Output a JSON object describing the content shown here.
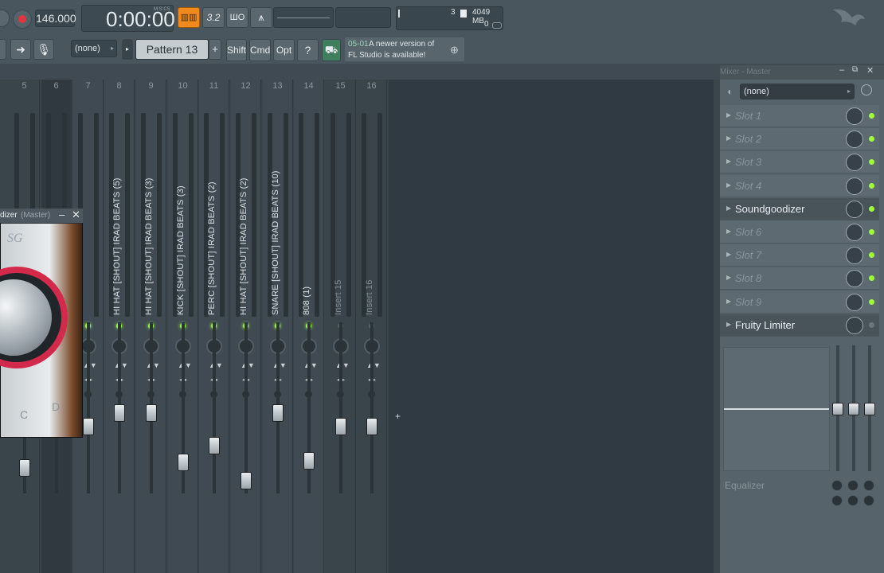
{
  "toolbar": {
    "tempo": "146.000",
    "time": "0:00:00",
    "time_units": "M:S:CS",
    "cpu": "3",
    "memory": "4049 MB",
    "voices": "0",
    "icon_32": "3.2",
    "icon_wo": "ШO"
  },
  "toolbar2": {
    "preset": "(none)",
    "pattern": "Pattern 13",
    "plus": "+",
    "shift": "Shift",
    "cmd": "Cmd",
    "opt": "Opt",
    "news_date": "05-01",
    "news_text_1": "A newer version of",
    "news_text_2": "FL Studio is available!"
  },
  "mixer": {
    "tracks": [
      {
        "num": "5",
        "name": ""
      },
      {
        "num": "6",
        "name": ""
      },
      {
        "num": "7",
        "name": ""
      },
      {
        "num": "8",
        "name": "HI HAT [SHOUT] IRAD BEATS (5)"
      },
      {
        "num": "9",
        "name": "HI HAT [SHOUT] IRAD BEATS (3)"
      },
      {
        "num": "10",
        "name": "KICK [SHOUT] IRAD BEATS (3)"
      },
      {
        "num": "11",
        "name": "PERC [SHOUT] IRAD BEATS (2)"
      },
      {
        "num": "12",
        "name": "HI HAT [SHOUT] IRAD BEATS (2)"
      },
      {
        "num": "13",
        "name": "SNARE [SHOUT] IRAD BEATS (10)"
      },
      {
        "num": "14",
        "name": "808 (1)"
      },
      {
        "num": "15",
        "name": "Insert 15"
      },
      {
        "num": "16",
        "name": "Insert 16"
      }
    ]
  },
  "plugin": {
    "title": "dizer",
    "title_suffix": "(Master)",
    "label_c": "C",
    "label_d": "D"
  },
  "panel": {
    "title": "Mixer - Master",
    "preset": "(none)",
    "slots": [
      {
        "label": "Slot 1",
        "active": false
      },
      {
        "label": "Slot 2",
        "active": false
      },
      {
        "label": "Slot 3",
        "active": false
      },
      {
        "label": "Slot 4",
        "active": false
      },
      {
        "label": "Soundgoodizer",
        "active": true
      },
      {
        "label": "Slot 6",
        "active": false
      },
      {
        "label": "Slot 7",
        "active": false
      },
      {
        "label": "Slot 8",
        "active": false
      },
      {
        "label": "Slot 9",
        "active": false
      },
      {
        "label": "Fruity Limiter",
        "active": true
      }
    ],
    "eq_label": "Equalizer"
  },
  "colors": {
    "accent": "#f08a1c",
    "led": "#9cff3a",
    "record": "#e0353a"
  }
}
